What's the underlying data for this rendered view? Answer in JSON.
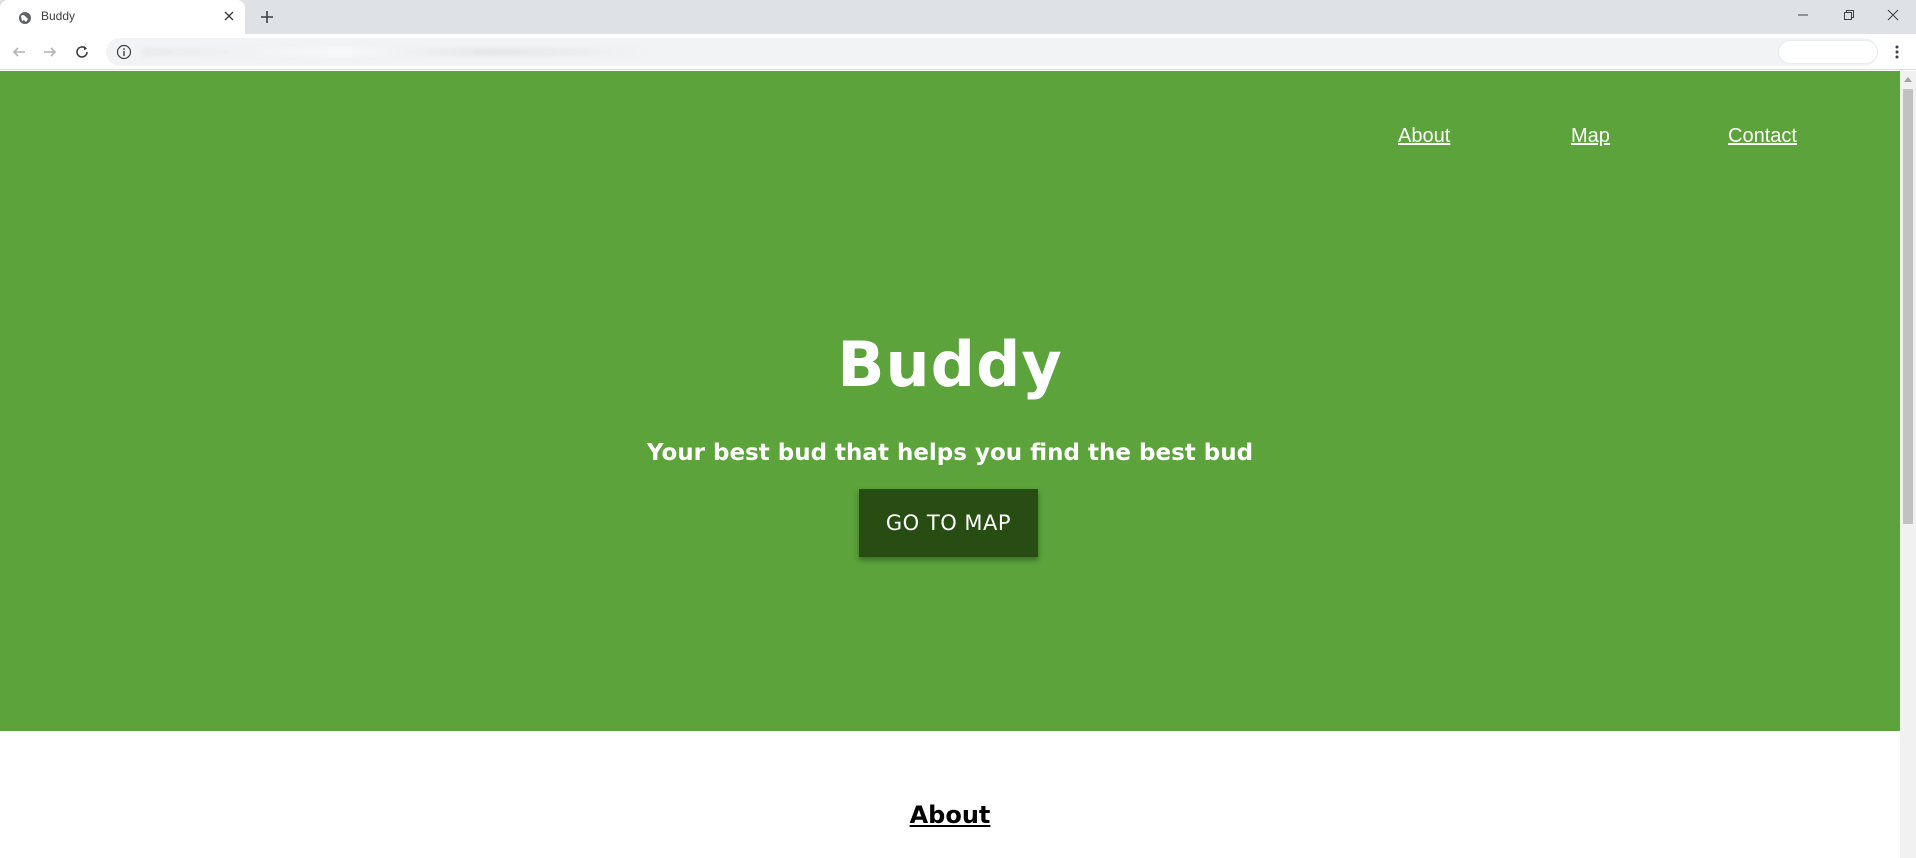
{
  "browser": {
    "tab_title": "Buddy",
    "url": ""
  },
  "nav": {
    "about": "About",
    "map": "Map",
    "contact": "Contact"
  },
  "hero": {
    "title": "Buddy",
    "subtitle": "Your best bud that helps you find the best bud",
    "button_label": "GO TO MAP"
  },
  "about": {
    "heading": "About"
  },
  "colors": {
    "hero_background": "#5ba33a",
    "button_background": "#284d12",
    "text_on_hero": "#ffffff"
  },
  "icons": [
    "globe-icon",
    "close-icon",
    "plus-icon",
    "minimize-icon",
    "restore-icon",
    "window-close-icon",
    "back-icon",
    "forward-icon",
    "reload-icon",
    "info-icon",
    "menu-dots-icon"
  ]
}
